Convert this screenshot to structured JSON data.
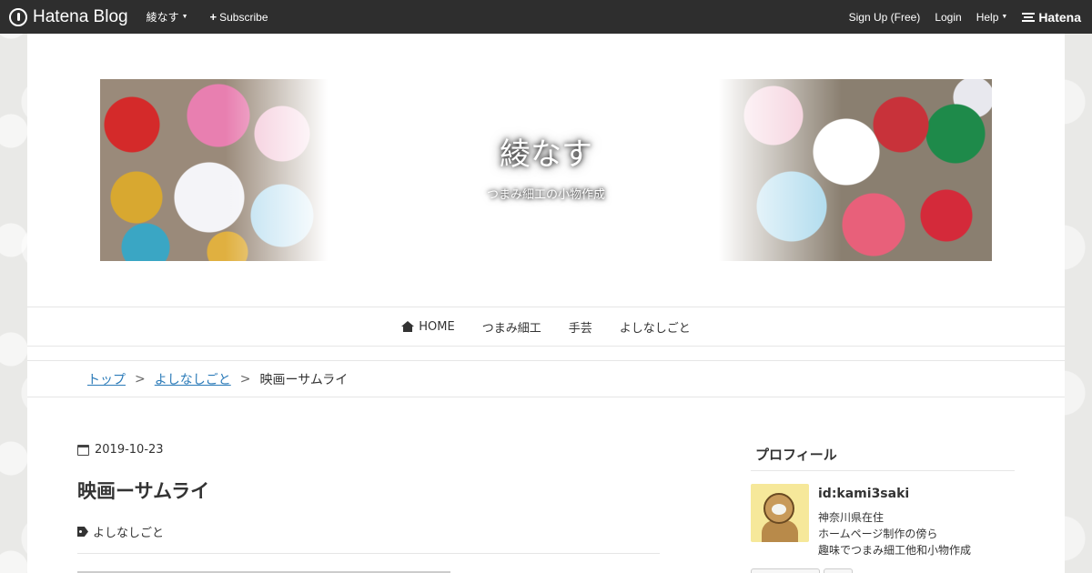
{
  "topbar": {
    "logo_text": "Hatena Blog",
    "blog_menu": "綾なす",
    "subscribe": "Subscribe",
    "signup": "Sign Up (Free)",
    "login": "Login",
    "help": "Help",
    "brand": "Hatena"
  },
  "header": {
    "title": "綾なす",
    "description": "つまみ細工の小物作成"
  },
  "nav": {
    "items": [
      {
        "label": "HOME"
      },
      {
        "label": "つまみ細工"
      },
      {
        "label": "手芸"
      },
      {
        "label": "よしなしごと"
      }
    ]
  },
  "breadcrumb": {
    "top": "トップ",
    "category": "よしなしごと",
    "current": "映画ーサムライ",
    "sep": ">"
  },
  "entry": {
    "date": "2019-10-23",
    "title": "映画ーサムライ",
    "category": "よしなしごと"
  },
  "sidebar": {
    "profile_title": "プロフィール",
    "user_id": "id:kami3saki",
    "desc_lines": [
      "神奈川県在住",
      "ホームページ制作の傍ら",
      "趣味でつまみ細工他和小物作成"
    ]
  }
}
